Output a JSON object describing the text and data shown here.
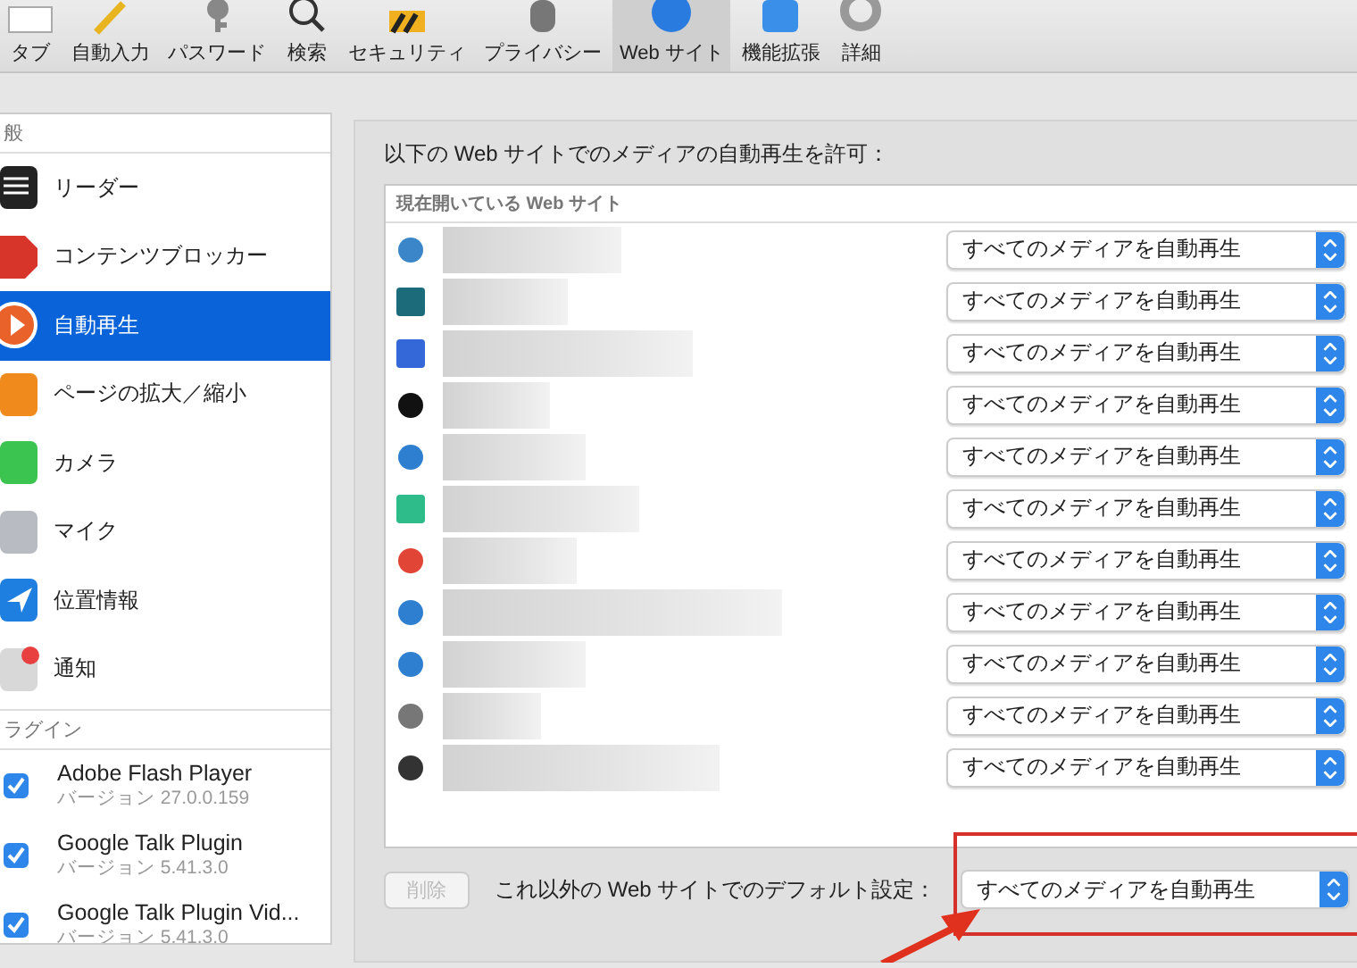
{
  "toolbar": {
    "items": [
      {
        "label": "タブ",
        "selected": false
      },
      {
        "label": "自動入力",
        "selected": false
      },
      {
        "label": "パスワード",
        "selected": false
      },
      {
        "label": "検索",
        "selected": false
      },
      {
        "label": "セキュリティ",
        "selected": false
      },
      {
        "label": "プライバシー",
        "selected": false
      },
      {
        "label": "Web サイト",
        "selected": true
      },
      {
        "label": "機能拡張",
        "selected": false
      },
      {
        "label": "詳細",
        "selected": false
      }
    ]
  },
  "sidebar": {
    "general_title": "般",
    "items": [
      {
        "label": "リーダー",
        "selected": false
      },
      {
        "label": "コンテンツブロッカー",
        "selected": false
      },
      {
        "label": "自動再生",
        "selected": true
      },
      {
        "label": "ページの拡大／縮小",
        "selected": false
      },
      {
        "label": "カメラ",
        "selected": false
      },
      {
        "label": "マイク",
        "selected": false
      },
      {
        "label": "位置情報",
        "selected": false
      },
      {
        "label": "通知",
        "selected": false
      }
    ],
    "plugins_title": "ラグイン",
    "plugins": [
      {
        "name": "Adobe Flash Player",
        "version": "バージョン 27.0.0.159",
        "checked": true
      },
      {
        "name": "Google Talk Plugin",
        "version": "バージョン 5.41.3.0",
        "checked": true
      },
      {
        "name": "Google Talk Plugin Vid...",
        "version": "バージョン 5.41.3.0",
        "checked": true
      }
    ]
  },
  "main": {
    "heading": "以下の Web サイトでのメディアの自動再生を許可：",
    "table_header": "現在開いている Web サイト",
    "rows": [
      {
        "option": "すべてのメディアを自動再生"
      },
      {
        "option": "すべてのメディアを自動再生"
      },
      {
        "option": "すべてのメディアを自動再生"
      },
      {
        "option": "すべてのメディアを自動再生"
      },
      {
        "option": "すべてのメディアを自動再生"
      },
      {
        "option": "すべてのメディアを自動再生"
      },
      {
        "option": "すべてのメディアを自動再生"
      },
      {
        "option": "すべてのメディアを自動再生"
      },
      {
        "option": "すべてのメディアを自動再生"
      },
      {
        "option": "すべてのメディアを自動再生"
      },
      {
        "option": "すべてのメディアを自動再生"
      }
    ],
    "delete_button": {
      "label": "削除",
      "disabled": true
    },
    "default_label": "これ以外の Web サイトでのデフォルト設定：",
    "default_value": "すべてのメディアを自動再生"
  }
}
